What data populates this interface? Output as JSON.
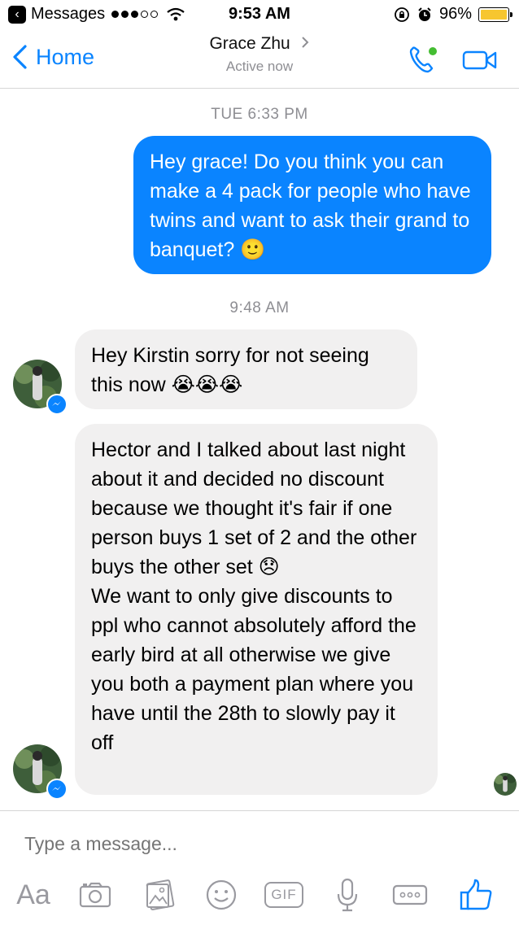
{
  "status_bar": {
    "carrier": "Messages",
    "time": "9:53 AM",
    "battery": "96%",
    "battery_level": 0.96
  },
  "nav": {
    "back_label": "Home",
    "contact_name": "Grace Zhu",
    "contact_status": "Active now"
  },
  "messages": {
    "timestamp_1": "TUE 6:33 PM",
    "outgoing_1": "Hey grace! Do you think you can make a 4 pack for people who have twins and want to ask their grand to banquet? 🙂",
    "timestamp_2": "9:48 AM",
    "incoming_1": "Hey Kirstin sorry for not seeing this now 😭😭😭",
    "incoming_2_part1": "Hector and I talked about last night about it and decided no discount because we thought it's fair if one person buys 1 set of 2 and the other buys the other set 😞",
    "incoming_2_part2": "We want to only give discounts to ppl who cannot absolutely afford the early bird at all otherwise we give you both a payment plan where you have until the 28th to slowly pay it off"
  },
  "composer": {
    "placeholder": "Type a message...",
    "aa_label": "Aa",
    "gif_label": "GIF"
  },
  "icons": {
    "back": "chevron-left-icon",
    "call": "phone-icon",
    "video": "video-camera-icon",
    "camera": "camera-icon",
    "gallery": "image-icon",
    "emoji": "smiley-icon",
    "mic": "microphone-icon",
    "more": "more-icon",
    "like": "thumbs-up-icon"
  },
  "colors": {
    "accent": "#0a84ff",
    "incoming_bubble": "#f1f0f0",
    "muted": "#8e8e93"
  }
}
